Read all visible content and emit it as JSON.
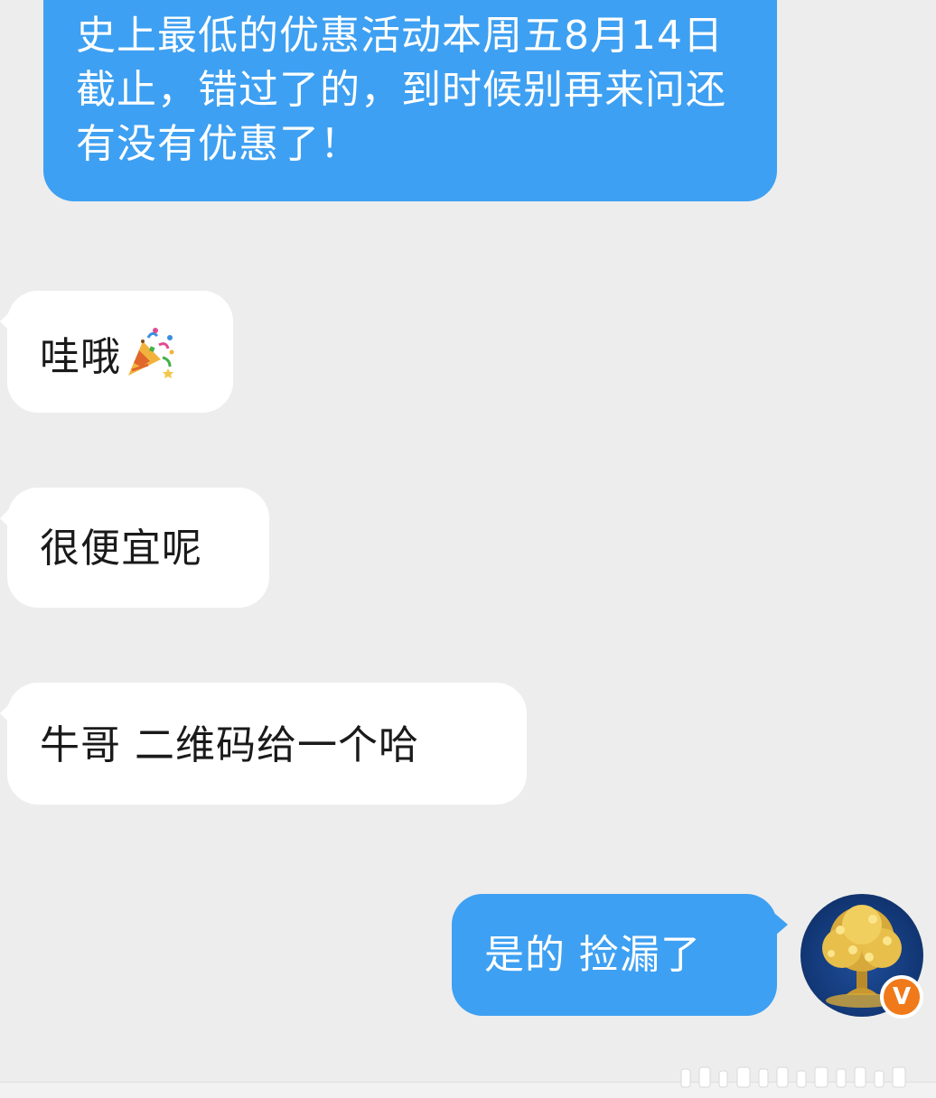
{
  "messages": [
    {
      "id": "msg1",
      "direction": "outgoing",
      "text": "史上最低的优惠活动本周五8月14日截止，错过了的，到时候别再来问还有没有优惠了！"
    },
    {
      "id": "msg2",
      "direction": "incoming",
      "text": "哇哦",
      "emoji": "party-popper-icon"
    },
    {
      "id": "msg3",
      "direction": "incoming",
      "text": "很便宜呢"
    },
    {
      "id": "msg4",
      "direction": "incoming",
      "text": "牛哥 二维码给一个哈"
    },
    {
      "id": "msg5",
      "direction": "outgoing",
      "text": "是的 捡漏了"
    }
  ],
  "avatar": {
    "icon": "money-tree-avatar-icon",
    "badge": "V",
    "badge_color": "#f07a1a"
  },
  "colors": {
    "background": "#ededed",
    "outgoing_bubble": "#3ea0f2",
    "incoming_bubble": "#ffffff"
  }
}
